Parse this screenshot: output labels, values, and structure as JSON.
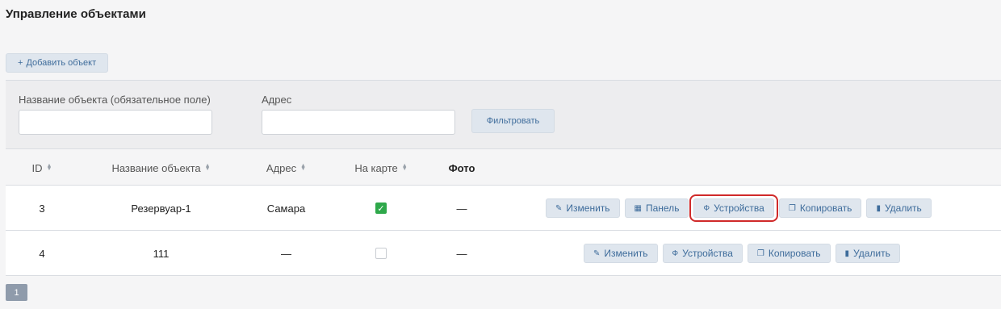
{
  "page": {
    "title": "Управление объектами"
  },
  "toolbar": {
    "add_icon": "+",
    "add_label": "Добавить объект"
  },
  "filter": {
    "name_label": "Название объекта (обязательное поле)",
    "name_value": "",
    "address_label": "Адрес",
    "address_value": "",
    "submit_label": "Фильтровать"
  },
  "table": {
    "headers": {
      "id": "ID",
      "name": "Название объекта",
      "address": "Адрес",
      "on_map": "На карте",
      "photo": "Фото"
    },
    "rows": [
      {
        "id": "3",
        "name": "Резервуар-1",
        "address": "Самара",
        "on_map": true,
        "photo": "—",
        "actions": {
          "edit": "Изменить",
          "panel": "Панель",
          "devices": "Устройства",
          "copy": "Копировать",
          "delete": "Удалить"
        }
      },
      {
        "id": "4",
        "name": "111",
        "address": "—",
        "on_map": false,
        "photo": "—",
        "actions": {
          "edit": "Изменить",
          "devices": "Устройства",
          "copy": "Копировать",
          "delete": "Удалить"
        }
      }
    ]
  },
  "icons": {
    "edit": "pencil-icon",
    "panel": "dashboard-icon",
    "devices": "device-icon",
    "copy": "copy-icon",
    "delete": "trash-icon",
    "sort": "sort-icon",
    "check": "checkmark-icon"
  },
  "pagination": {
    "current": "1"
  },
  "colors": {
    "accent": "#3e6c9b",
    "highlight": "#d02a2a",
    "checked": "#2ea84a"
  }
}
